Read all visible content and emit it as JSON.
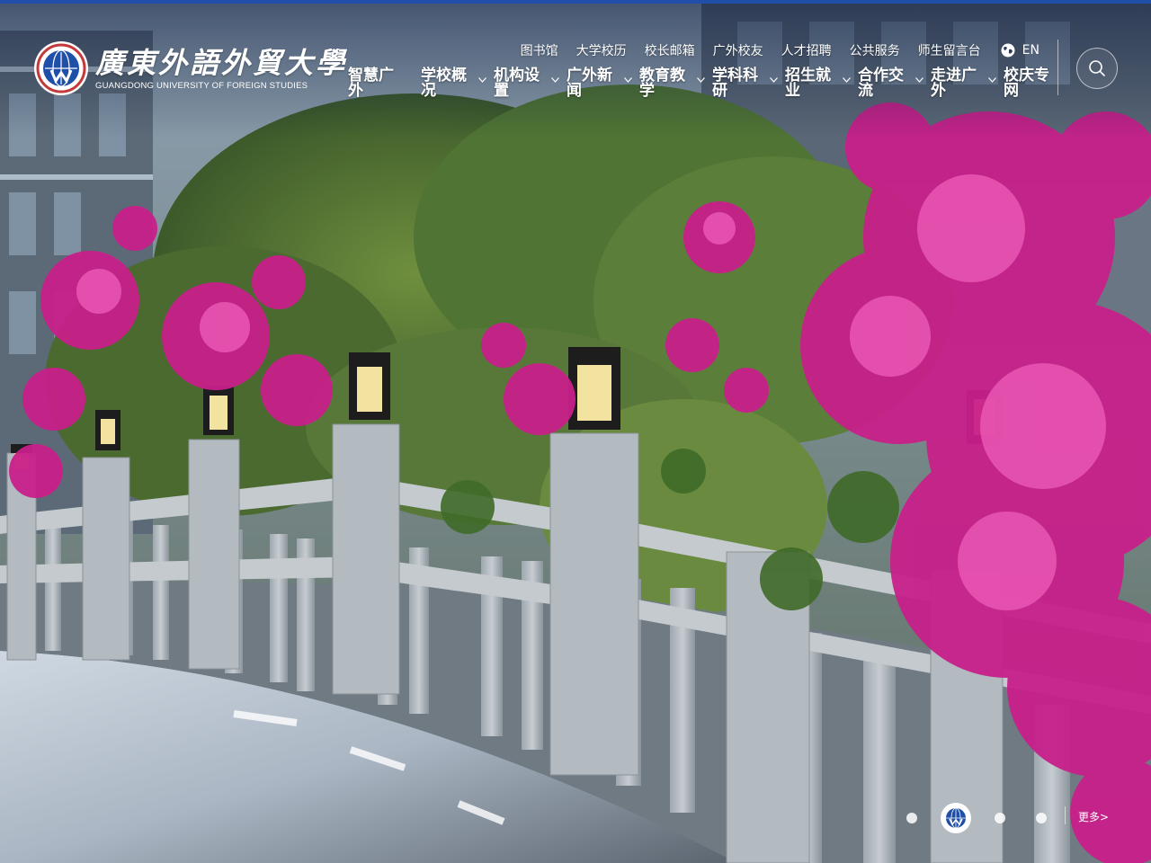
{
  "header": {
    "logo_cn": "廣東外語外貿大學",
    "logo_en": "GUANGDONG UNIVERSITY OF FOREIGN STUDIES"
  },
  "utility_nav": {
    "items": [
      "图书馆",
      "大学校历",
      "校长邮箱",
      "广外校友",
      "人才招聘",
      "公共服务",
      "师生留言台"
    ],
    "language": "EN"
  },
  "main_nav": {
    "items": [
      {
        "label": "智慧广外",
        "has_dropdown": false
      },
      {
        "label": "学校概况",
        "has_dropdown": true
      },
      {
        "label": "机构设置",
        "has_dropdown": true
      },
      {
        "label": "广外新闻",
        "has_dropdown": true
      },
      {
        "label": "教育教学",
        "has_dropdown": true
      },
      {
        "label": "学科科研",
        "has_dropdown": true
      },
      {
        "label": "招生就业",
        "has_dropdown": true
      },
      {
        "label": "合作交流",
        "has_dropdown": true
      },
      {
        "label": "走进广外",
        "has_dropdown": true
      },
      {
        "label": "校庆专网",
        "has_dropdown": false
      }
    ]
  },
  "icons": {
    "search": "search-icon",
    "globe": "globe-icon",
    "chevron": "chevron-down-icon",
    "emblem": "university-emblem-icon"
  },
  "slider": {
    "slide_count": 4,
    "active_index": 1,
    "more_label": "更多>"
  },
  "colors": {
    "accent": "#1f4fa8",
    "flower": "#d01f8c",
    "text": "#ffffff"
  }
}
